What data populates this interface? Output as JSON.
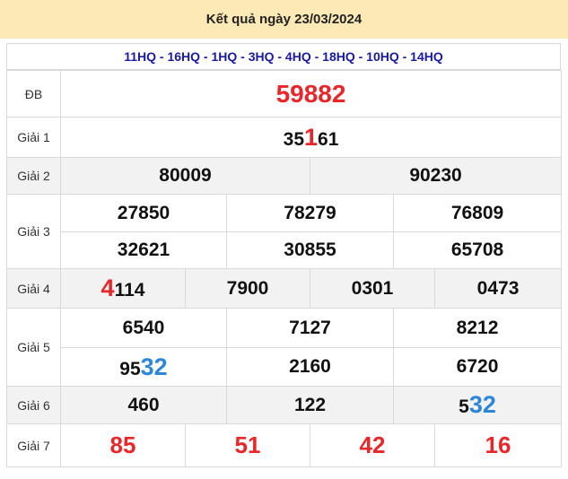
{
  "title": "Kết quả ngày 23/03/2024",
  "codes": "11HQ - 16HQ - 1HQ - 3HQ - 4HQ - 18HQ - 10HQ - 14HQ",
  "labels": {
    "db": "ĐB",
    "g1": "Giải 1",
    "g2": "Giải 2",
    "g3": "Giải 3",
    "g4": "Giải 4",
    "g5": "Giải 5",
    "g6": "Giải 6",
    "g7": "Giải 7"
  },
  "prizes": {
    "db": "59882",
    "g1": {
      "pre": "35",
      "hl": "1",
      "post": "61"
    },
    "g2": [
      "80009",
      "90230"
    ],
    "g3": [
      "27850",
      "78279",
      "76809",
      "32621",
      "30855",
      "65708"
    ],
    "g4": [
      {
        "hl": "4",
        "post": "114"
      },
      "7900",
      "0301",
      "0473"
    ],
    "g5": [
      "6540",
      "7127",
      "8212",
      {
        "pre": "95",
        "hl": "32"
      },
      "2160",
      "6720"
    ],
    "g6": [
      "460",
      "122",
      {
        "pre": "5",
        "hl": "32"
      }
    ],
    "g7": [
      "85",
      "51",
      "42",
      "16"
    ]
  },
  "colors": {
    "header_bg": "#fde9b6",
    "codes_text": "#1a1a9e",
    "highlight_red": "#e8272b",
    "highlight_blue": "#2d86d6",
    "alt_row_bg": "#f2f2f2"
  }
}
